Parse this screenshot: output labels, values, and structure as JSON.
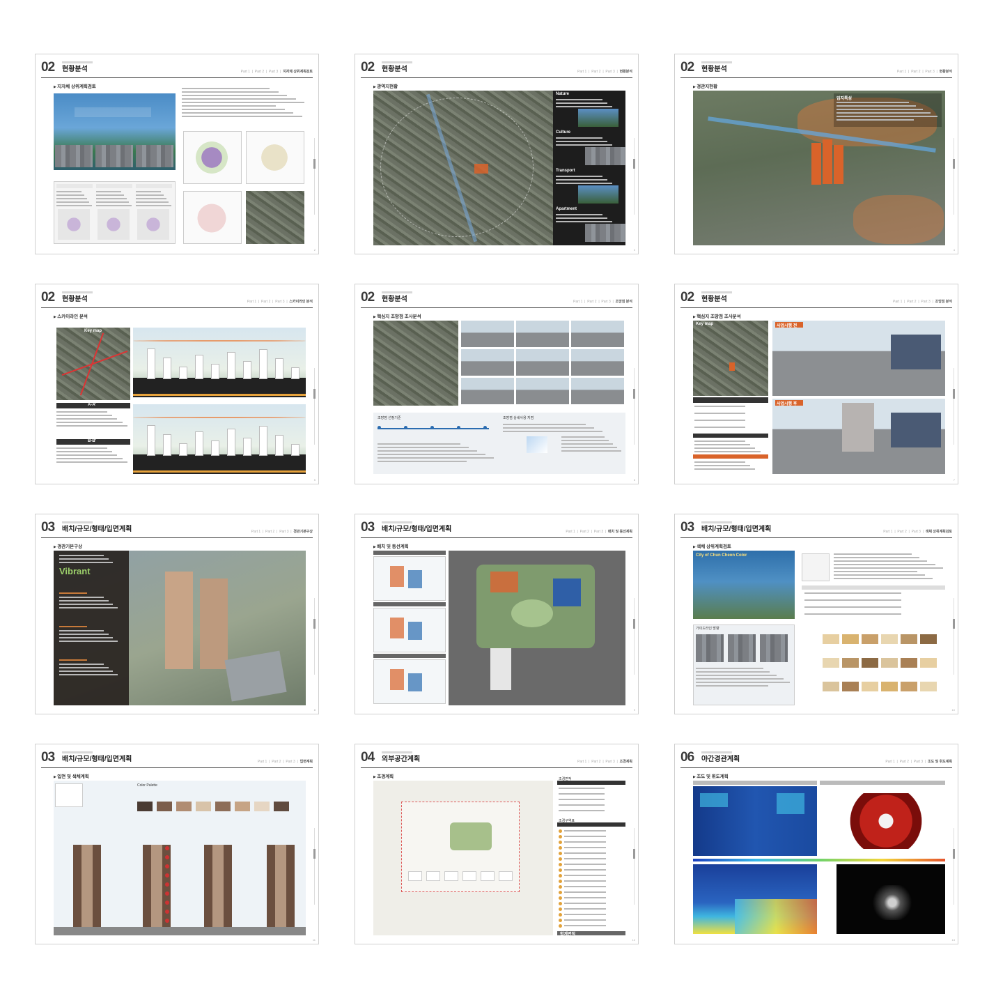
{
  "pages": [
    {
      "num": "02",
      "title": "현황분석",
      "section": "지자체 상위계획검토",
      "crumb": "지자체 상위계획검토",
      "page_no": "2"
    },
    {
      "num": "02",
      "title": "현황분석",
      "section": "광역지현황",
      "crumb": "현황분석",
      "page_no": "3",
      "labels": [
        "Nature",
        "Culture",
        "Transport",
        "Apartment"
      ]
    },
    {
      "num": "02",
      "title": "현황분석",
      "section": "경관지현황",
      "crumb": "현황분석",
      "page_no": "4",
      "labels": [
        "입지특성"
      ]
    },
    {
      "num": "02",
      "title": "현황분석",
      "section": "스카이라인 분석",
      "crumb": "스카이라인 분석",
      "page_no": "5",
      "labels": [
        "Key map",
        "A-A'",
        "B-B'"
      ]
    },
    {
      "num": "02",
      "title": "현황분석",
      "section": "핵심지 조망점 조사분석",
      "crumb": "조망점 분석",
      "page_no": "6",
      "labels": [
        "조망점 선정기준",
        "조망점 상세사용 지점"
      ]
    },
    {
      "num": "02",
      "title": "현황분석",
      "section": "핵심지 조망점 조사분석",
      "crumb": "조망점 분석",
      "page_no": "7",
      "labels": [
        "Key map",
        "사업시행 전",
        "사업시행 후"
      ]
    },
    {
      "num": "03",
      "title": "배치/규모/형태/입면계획",
      "section": "경관기본구상",
      "crumb": "경관기본구상",
      "page_no": "8",
      "labels": [
        "Vibrant"
      ]
    },
    {
      "num": "03",
      "title": "배치/규모/형태/입면계획",
      "section": "배치 및 동선계획",
      "crumb": "배치 및 동선계획",
      "page_no": "9"
    },
    {
      "num": "03",
      "title": "배치/규모/형태/입면계획",
      "section": "색채 상위계획검토",
      "crumb": "색채 상위계획검토",
      "page_no": "10",
      "labels": [
        "City of Chun Cheon Color",
        "가이드라인 방향"
      ]
    },
    {
      "num": "03",
      "title": "배치/규모/형태/입면계획",
      "section": "입면 및 색채계획",
      "crumb": "입면계획",
      "page_no": "11",
      "labels": [
        "Color Palette"
      ]
    },
    {
      "num": "04",
      "title": "외부공간계획",
      "section": "조경계획",
      "crumb": "조경계획",
      "page_no": "12",
      "labels": [
        "조경면적",
        "조경구역표",
        "합계면적"
      ]
    },
    {
      "num": "06",
      "title": "야간경관계획",
      "section": "조도 및 휘도계획",
      "crumb": "조도 및 휘도계획",
      "page_no": "13"
    }
  ],
  "colors": {
    "accent_orange": "#d9632a",
    "dark_panel": "#3a3532",
    "aerial": "#5f6657",
    "sky": "#c9dbe6"
  }
}
